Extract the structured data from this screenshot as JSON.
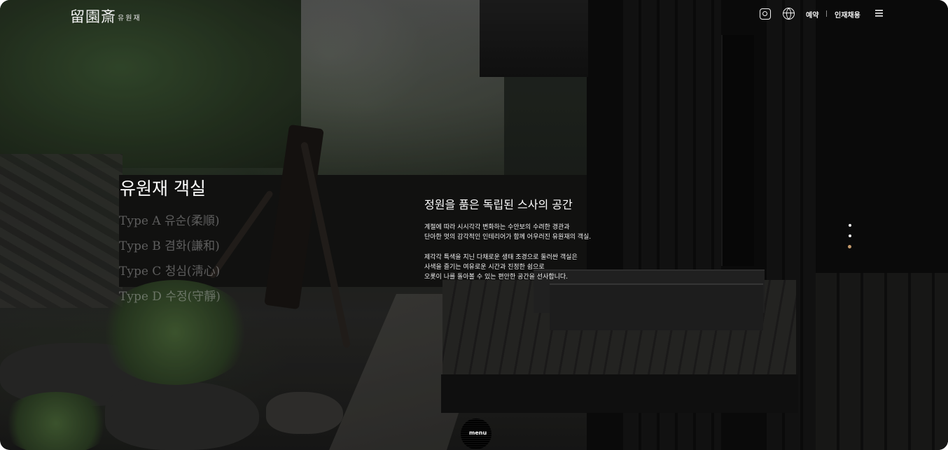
{
  "header": {
    "logo_mark": "留園斎",
    "logo_text": "유원재",
    "reserve_label": "예약",
    "careers_label": "인재채용"
  },
  "rooms": {
    "title": "유원재 객실",
    "types": [
      {
        "label": "Type A  유순(柔順)"
      },
      {
        "label": "Type B  겸화(謙和)"
      },
      {
        "label": "Type C  청심(淸心)"
      },
      {
        "label": "Type D  수정(守靜)"
      }
    ]
  },
  "description": {
    "heading": "정원을 품은 독립된 스사의 공간",
    "paragraph1_line1": "계절에 따라 시시각각 변화하는 수안보의 수려한 경관과",
    "paragraph1_line2": "단아한 멋의 감각적인 인테리어가 함께 어우러진 유원재의 객실.",
    "paragraph2_line1": "제각각 특색을 지닌 다채로운 생태 조경으로 둘러싼 객실은",
    "paragraph2_line2": "사색을 즐기는 여유로운 시간과 진정한 쉼으로",
    "paragraph2_line3": "오롯이 나를 돌아볼 수 있는 편안한 공간을 선사합니다."
  },
  "pager": {
    "active_index": 2,
    "count": 3
  },
  "menu": {
    "label": "menu"
  },
  "colors": {
    "accent": "#c49a6c"
  }
}
